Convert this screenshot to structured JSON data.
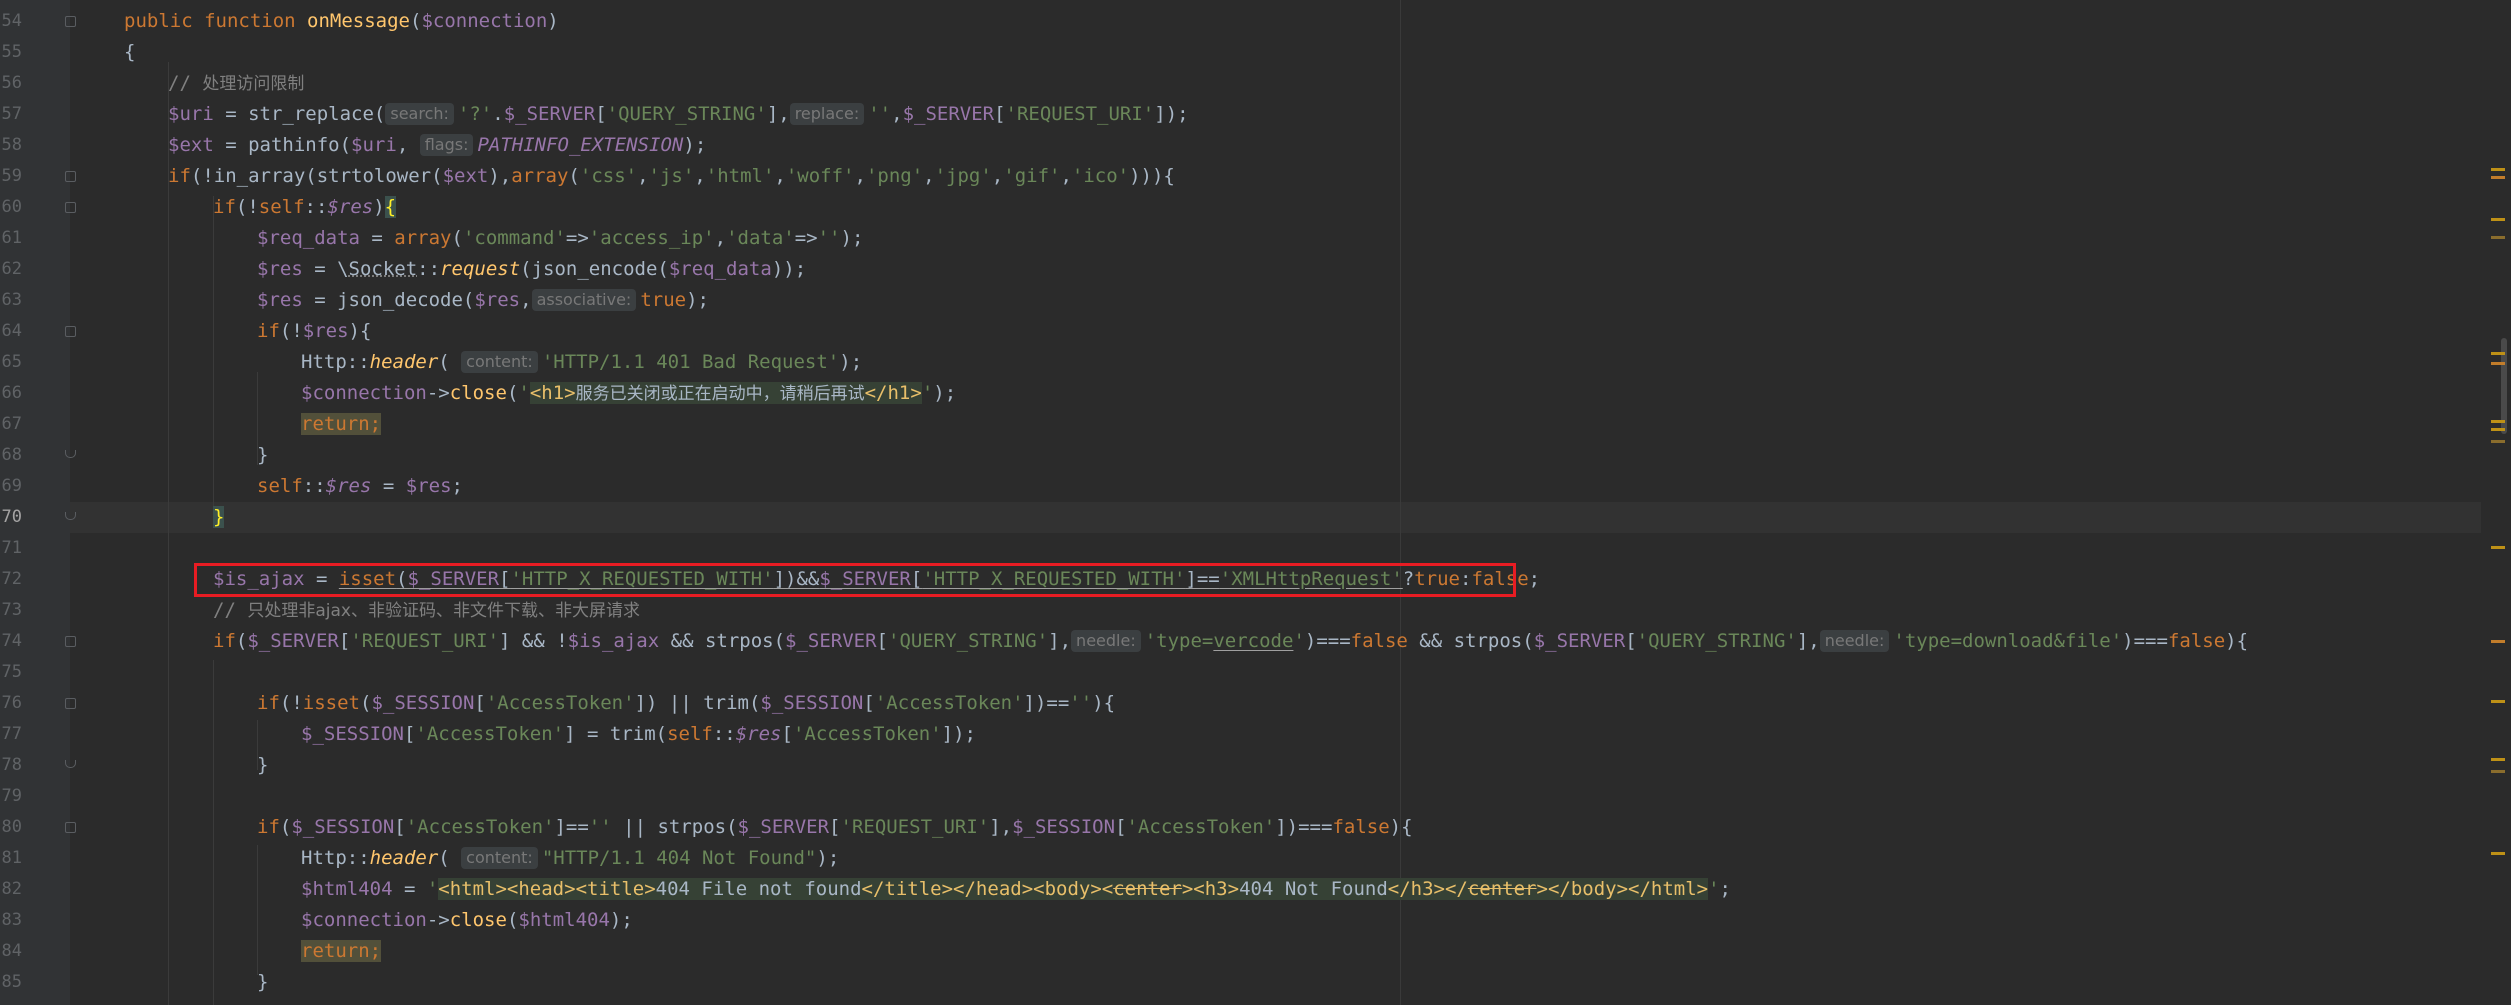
{
  "editor": {
    "current_line": "70",
    "lines": [
      {
        "n": "54",
        "text": "public function onMessage($connection)"
      },
      {
        "n": "55",
        "text": "{"
      },
      {
        "n": "56",
        "text": "// 处理访问限制"
      },
      {
        "n": "57",
        "text": "$uri = str_replace( search: '?'.$_SERVER['QUERY_STRING'], replace: '',$_SERVER['REQUEST_URI']);"
      },
      {
        "n": "58",
        "text": "$ext = pathinfo($uri, flags: PATHINFO_EXTENSION);"
      },
      {
        "n": "59",
        "text": "if(!in_array(strtolower($ext),array('css','js','html','woff','png','jpg','gif','ico'))){"
      },
      {
        "n": "60",
        "text": "if(!self::$res){"
      },
      {
        "n": "61",
        "text": "$req_data = array('command'=>'access_ip','data'=>'');"
      },
      {
        "n": "62",
        "text": "$res = \\Socket::request(json_encode($req_data));"
      },
      {
        "n": "63",
        "text": "$res = json_decode($res, associative: true);"
      },
      {
        "n": "64",
        "text": "if(!$res){"
      },
      {
        "n": "65",
        "text": "Http::header( content: 'HTTP/1.1 401 Bad Request');"
      },
      {
        "n": "66",
        "text": "$connection->close('<h1>服务已关闭或正在启动中，请稍后再试</h1>');"
      },
      {
        "n": "67",
        "text": "return;"
      },
      {
        "n": "68",
        "text": "}"
      },
      {
        "n": "69",
        "text": "self::$res = $res;"
      },
      {
        "n": "70",
        "text": "}"
      },
      {
        "n": "71",
        "text": ""
      },
      {
        "n": "72",
        "text": "$is_ajax = isset($_SERVER['HTTP_X_REQUESTED_WITH'])&&$_SERVER['HTTP_X_REQUESTED_WITH']=='XMLHttpRequest'?true:false;"
      },
      {
        "n": "73",
        "text": "// 只处理非ajax、非验证码、非文件下载、非大屏请求"
      },
      {
        "n": "74",
        "text": "if($_SERVER['REQUEST_URI'] && !$is_ajax && strpos($_SERVER['QUERY_STRING'], needle: 'type=vercode')===false && strpos($_SERVER['QUERY_STRING'], needle: 'type=download&file')===false){"
      },
      {
        "n": "75",
        "text": ""
      },
      {
        "n": "76",
        "text": "if(!isset($_SESSION['AccessToken']) || trim($_SESSION['AccessToken'])==''){"
      },
      {
        "n": "77",
        "text": "$_SESSION['AccessToken'] = trim(self::$res['AccessToken']);"
      },
      {
        "n": "78",
        "text": "}"
      },
      {
        "n": "79",
        "text": ""
      },
      {
        "n": "80",
        "text": "if($_SESSION['AccessToken']=='' || strpos($_SERVER['REQUEST_URI'],$_SESSION['AccessToken'])===false){"
      },
      {
        "n": "81",
        "text": "Http::header( content: \"HTTP/1.1 404 Not Found\");"
      },
      {
        "n": "82",
        "text": "$html404 = '<html><head><title>404 File not found</title></head><body><center><h3>404 Not Found</h3></center></body></html>';"
      },
      {
        "n": "83",
        "text": "$connection->close($html404);"
      },
      {
        "n": "84",
        "text": "return;"
      },
      {
        "n": "85",
        "text": "}"
      }
    ]
  },
  "hints": {
    "search": "search:",
    "replace": "replace:",
    "flags": "flags:",
    "associative": "associative:",
    "content": "content:",
    "needle": "needle:"
  },
  "colors": {
    "background": "#2b2b2b",
    "keyword": "#cc7832",
    "function": "#ffc66d",
    "variable": "#9876aa",
    "string": "#6a8759",
    "comment": "#808080",
    "highlight_box": "#e81c23"
  }
}
